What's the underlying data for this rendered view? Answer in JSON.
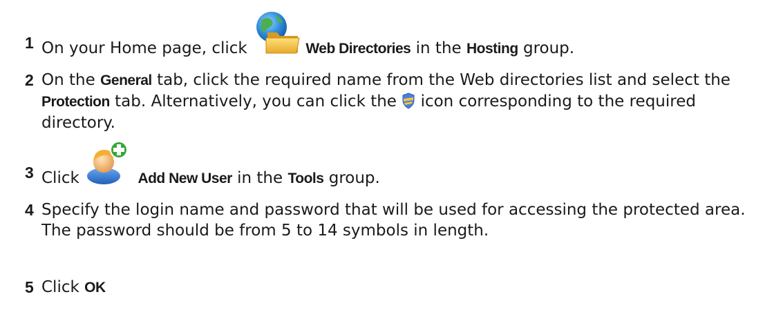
{
  "steps": [
    {
      "number": "1",
      "text_a": "On your Home page, click",
      "strong_a": "Web Directories",
      "text_b": "in the",
      "strong_b": "Hosting",
      "text_c": "group.",
      "icon": "web-directories-icon"
    },
    {
      "number": "2",
      "text_a": "On the",
      "strong_a": "General",
      "text_b": "tab, click the required name from the Web directories list and select the",
      "strong_b": "Protection",
      "text_c": "tab. Alternatively, you can click the",
      "text_d": "icon corresponding to the required directory.",
      "icon": "protection-shield-icon"
    },
    {
      "number": "3",
      "text_a": "Click",
      "strong_a": "Add New User",
      "text_b": "in the",
      "strong_b": "Tools",
      "text_c": "group.",
      "icon": "add-user-icon"
    },
    {
      "number": "4",
      "text_a": "Specify the login name and password that will be used for accessing the protected area. The password should be from 5 to 14 symbols in length."
    },
    {
      "number": "5",
      "text_a": "Click",
      "strong_a": "OK",
      "text_b": "."
    }
  ],
  "colors": {
    "text": "#1a1a1a",
    "folder": "#f2c53d",
    "globe": "#2f8fd8",
    "shield": "#4a7fe0",
    "plus_badge": "#3aa63a"
  }
}
